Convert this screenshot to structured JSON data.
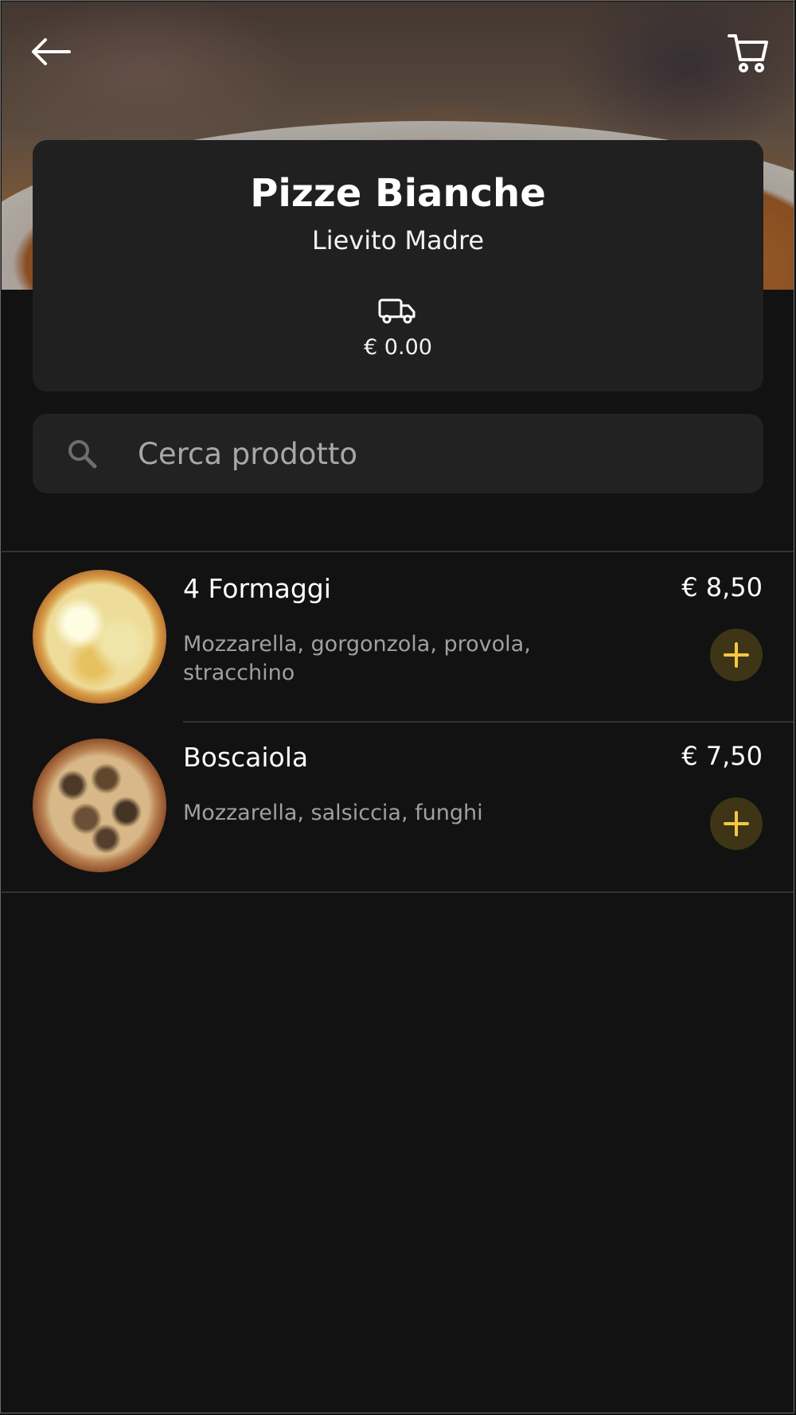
{
  "header": {
    "back_icon": "arrow-left-icon",
    "cart_icon": "shopping-cart-icon"
  },
  "category": {
    "title": "Pizze Bianche",
    "subtitle": "Lievito Madre",
    "delivery_icon": "truck-icon",
    "delivery_fee": "€ 0.00"
  },
  "search": {
    "placeholder": "Cerca prodotto",
    "value": "",
    "icon": "search-icon"
  },
  "products": [
    {
      "name": "4 Formaggi",
      "price": "€ 8,50",
      "description": "Mozzarella, gorgonzola, provola, stracchino",
      "add_icon": "plus-icon"
    },
    {
      "name": "Boscaiola",
      "price": "€ 7,50",
      "description": "Mozzarella, salsiccia, funghi",
      "add_icon": "plus-icon"
    }
  ],
  "colors": {
    "background": "#121212",
    "card": "#202020",
    "accent": "#f5c842",
    "accent_bg": "#3d3516",
    "muted_text": "#a0a0a0"
  }
}
